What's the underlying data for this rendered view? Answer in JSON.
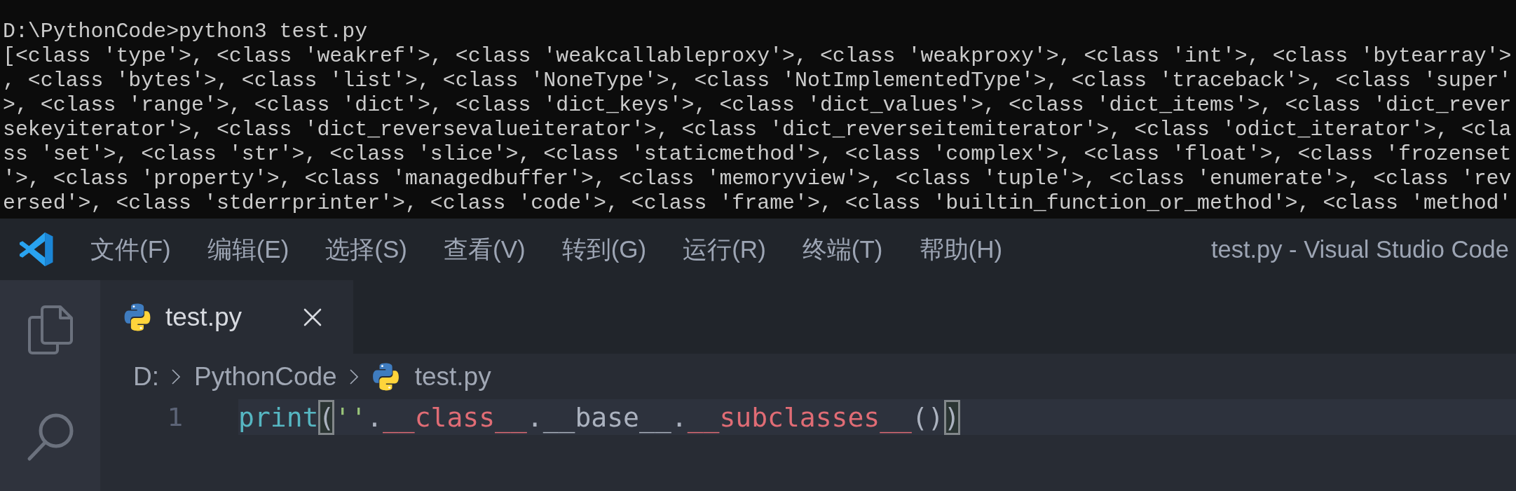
{
  "terminal": {
    "lines": [
      "D:\\PythonCode>python3 test.py",
      "[<class 'type'>, <class 'weakref'>, <class 'weakcallableproxy'>, <class 'weakproxy'>, <class 'int'>, <class 'bytearray'>",
      ", <class 'bytes'>, <class 'list'>, <class 'NoneType'>, <class 'NotImplementedType'>, <class 'traceback'>, <class 'super'",
      ">, <class 'range'>, <class 'dict'>, <class 'dict_keys'>, <class 'dict_values'>, <class 'dict_items'>, <class 'dict_rever",
      "sekeyiterator'>, <class 'dict_reversevalueiterator'>, <class 'dict_reverseitemiterator'>, <class 'odict_iterator'>, <cla",
      "ss 'set'>, <class 'str'>, <class 'slice'>, <class 'staticmethod'>, <class 'complex'>, <class 'float'>, <class 'frozenset",
      "'>, <class 'property'>, <class 'managedbuffer'>, <class 'memoryview'>, <class 'tuple'>, <class 'enumerate'>, <class 'rev",
      "ersed'>, <class 'stderrprinter'>, <class 'code'>, <class 'frame'>, <class 'builtin_function_or_method'>, <class 'method'"
    ]
  },
  "title_bar": {
    "menu": [
      "文件(F)",
      "编辑(E)",
      "选择(S)",
      "查看(V)",
      "转到(G)",
      "运行(R)",
      "终端(T)",
      "帮助(H)"
    ],
    "title": "test.py - Visual Studio Code"
  },
  "tabs": [
    {
      "label": "test.py",
      "selected": true
    }
  ],
  "breadcrumbs": [
    {
      "label": "D:",
      "kind": "folder"
    },
    {
      "label": "PythonCode",
      "kind": "folder"
    },
    {
      "label": "test.py",
      "kind": "file"
    }
  ],
  "editor": {
    "lines": [
      {
        "number": "1",
        "current": true,
        "tokens": [
          {
            "text": "print",
            "kind": "function"
          },
          {
            "text": "(",
            "kind": "bracket",
            "matched": true
          },
          {
            "text": "''",
            "kind": "string"
          },
          {
            "text": ".",
            "kind": "punctuation"
          },
          {
            "text": "__class__",
            "kind": "attribute"
          },
          {
            "text": ".",
            "kind": "punctuation"
          },
          {
            "text": "__base__",
            "kind": "identifier"
          },
          {
            "text": ".",
            "kind": "punctuation"
          },
          {
            "text": "__subclasses__",
            "kind": "attribute"
          },
          {
            "text": "()",
            "kind": "punctuation"
          },
          {
            "text": ")",
            "kind": "bracket",
            "matched": true
          }
        ]
      }
    ]
  }
}
